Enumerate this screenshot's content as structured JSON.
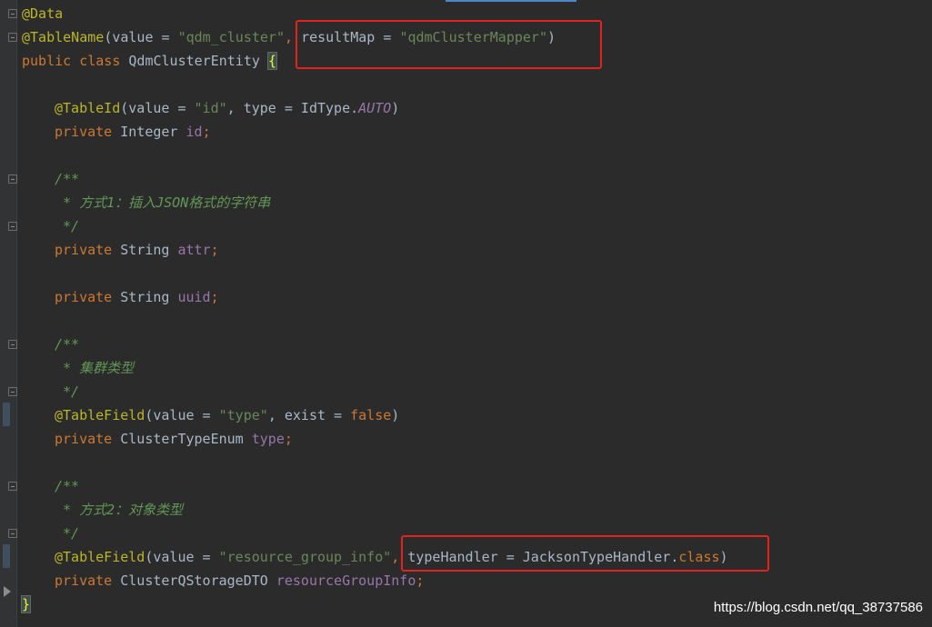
{
  "code": {
    "l1": "@Data",
    "l2": {
      "ann": "@TableName",
      "open": "(value = ",
      "str1": "\"qdm_cluster\"",
      "comma": ", ",
      "rm": "resultMap = ",
      "str2": "\"qdmClusterMapper\"",
      "close": ")"
    },
    "l3": {
      "kw": "public class ",
      "name": "QdmClusterEntity ",
      "brace": "{"
    },
    "l5": {
      "ann": "@TableId",
      "open": "(value = ",
      "str": "\"id\"",
      "mid": ", type = IdType.",
      "cst": "AUTO",
      "close": ")"
    },
    "l6": {
      "kw": "private ",
      "type": "Integer ",
      "fld": "id",
      "semi": ";"
    },
    "l8": "/**",
    "l9": " * 方式1：插入JSON格式的字符串",
    "l10": " */",
    "l11": {
      "kw": "private ",
      "type": "String ",
      "fld": "attr",
      "semi": ";"
    },
    "l13": {
      "kw": "private ",
      "type": "String ",
      "fld": "uuid",
      "semi": ";"
    },
    "l15": "/**",
    "l16": " * 集群类型",
    "l17": " */",
    "l18": {
      "ann": "@TableField",
      "open": "(value = ",
      "str": "\"type\"",
      "mid": ", exist = ",
      "kw": "false",
      "close": ")"
    },
    "l19": {
      "kw": "private ",
      "type": "ClusterTypeEnum ",
      "fld": "type",
      "semi": ";"
    },
    "l21": "/**",
    "l22": " * 方式2：对象类型",
    "l23": " */",
    "l24": {
      "ann": "@TableField",
      "open": "(value = ",
      "str": "\"resource_group_info\"",
      "comma": ", ",
      "th": "typeHandler = JacksonTypeHandler.",
      "kw": "class",
      "close": ")"
    },
    "l25": {
      "kw": "private ",
      "type": "ClusterQStorageDTO ",
      "fld": "resourceGroupInfo",
      "semi": ";"
    },
    "l26": "}"
  },
  "watermark": "https://blog.csdn.net/qq_38737586",
  "colors": {
    "background": "#2b2b2b",
    "annotation": "#bbb529",
    "keyword": "#cc7832",
    "string": "#6a8759",
    "field": "#9876aa",
    "comment": "#629755",
    "highlight_box": "#e1231f"
  }
}
